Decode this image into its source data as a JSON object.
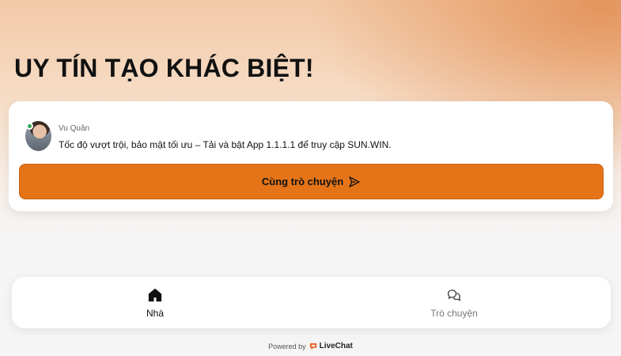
{
  "headline": "UY TÍN TẠO KHÁC BIỆT!",
  "card": {
    "agent_name": "Vu Quân",
    "message": "Tốc độ vượt trội, bảo mật tối ưu – Tải và bật App 1.1.1.1 để truy cập SUN.WIN.",
    "chat_button_label": "Cùng trò chuyện",
    "icons": {
      "avatar": "agent-avatar",
      "status": "online-dot",
      "button": "send-icon"
    }
  },
  "nav": {
    "items": [
      {
        "label": "Nhà",
        "icon": "home-icon",
        "active": true
      },
      {
        "label": "Trò chuyện",
        "icon": "chat-bubbles-icon",
        "active": false
      }
    ]
  },
  "footer": {
    "powered_by": "Powered by",
    "brand": "LiveChat",
    "brand_icon": "livechat-logo-icon"
  },
  "colors": {
    "accent": "#e57418",
    "brand": "#e8652b",
    "online": "#2fa84f"
  }
}
